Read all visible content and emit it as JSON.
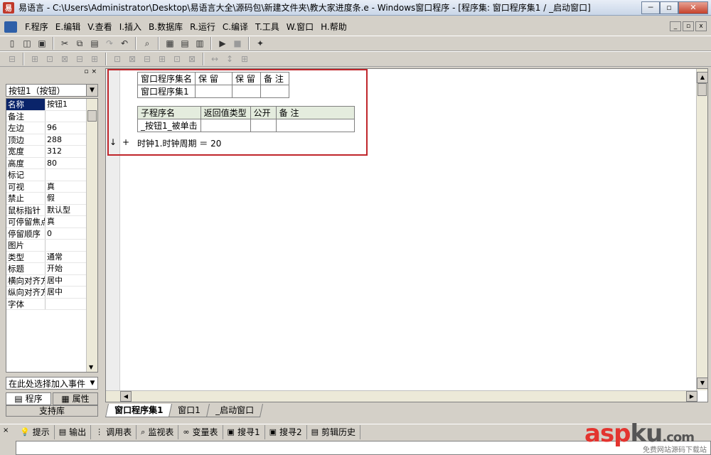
{
  "window": {
    "title": "易语言 - C:\\Users\\Administrator\\Desktop\\易语言大全\\源码包\\新建文件夹\\教大家进度条.e - Windows窗口程序 - [程序集: 窗口程序集1 / _启动窗口]",
    "minimize": "─",
    "maximize": "▫",
    "close": "✕"
  },
  "menu": {
    "items": [
      "F.程序",
      "E.编辑",
      "V.查看",
      "I.插入",
      "B.数据库",
      "R.运行",
      "C.编译",
      "T.工具",
      "W.窗口",
      "H.帮助"
    ],
    "mdi_min": "_",
    "mdi_restore": "▫",
    "mdi_close": "x"
  },
  "properties": {
    "object": "按钮1（按钮）",
    "rows": [
      {
        "name": "名称",
        "value": "按钮1",
        "selected": true
      },
      {
        "name": "备注",
        "value": ""
      },
      {
        "name": "左边",
        "value": "96"
      },
      {
        "name": "顶边",
        "value": "288"
      },
      {
        "name": "宽度",
        "value": "312"
      },
      {
        "name": "高度",
        "value": "80"
      },
      {
        "name": "标记",
        "value": ""
      },
      {
        "name": "可视",
        "value": "真"
      },
      {
        "name": "禁止",
        "value": "假"
      },
      {
        "name": "鼠标指针",
        "value": "默认型"
      },
      {
        "name": "可停留焦点",
        "value": "真"
      },
      {
        "name": "  停留顺序",
        "value": "0"
      },
      {
        "name": "图片",
        "value": ""
      },
      {
        "name": "类型",
        "value": "通常"
      },
      {
        "name": "标题",
        "value": "开始"
      },
      {
        "name": "横向对齐方式",
        "value": "居中"
      },
      {
        "name": "纵向对齐方式",
        "value": "居中"
      },
      {
        "name": "字体",
        "value": ""
      }
    ],
    "event_select": "在此处选择加入事件",
    "tab_program": "程序",
    "tab_props": "属性",
    "support_lib": "支持库"
  },
  "code": {
    "assembly_table": {
      "headers": [
        "窗口程序集名",
        "保 留",
        "保 留",
        "备 注"
      ],
      "row": [
        "窗口程序集1",
        "",
        "",
        ""
      ]
    },
    "sub_table": {
      "headers": [
        "子程序名",
        "返回值类型",
        "公开",
        "备 注"
      ],
      "row": [
        "_按钮1_被单击",
        "",
        "",
        ""
      ]
    },
    "line1": "时钟1.时钟周期 ＝ 20",
    "arrow_marker": "↓",
    "plus_marker": "+"
  },
  "doc_tabs": [
    "窗口程序集1",
    "窗口1",
    "_启动窗口"
  ],
  "bottom_tabs": [
    "提示",
    "输出",
    "调用表",
    "监视表",
    "变量表",
    "搜寻1",
    "搜寻2",
    "剪辑历史"
  ],
  "watermark": {
    "asp": "asp",
    "ku": "ku",
    "com": ".com",
    "sub": "免费网站源码下载站"
  }
}
